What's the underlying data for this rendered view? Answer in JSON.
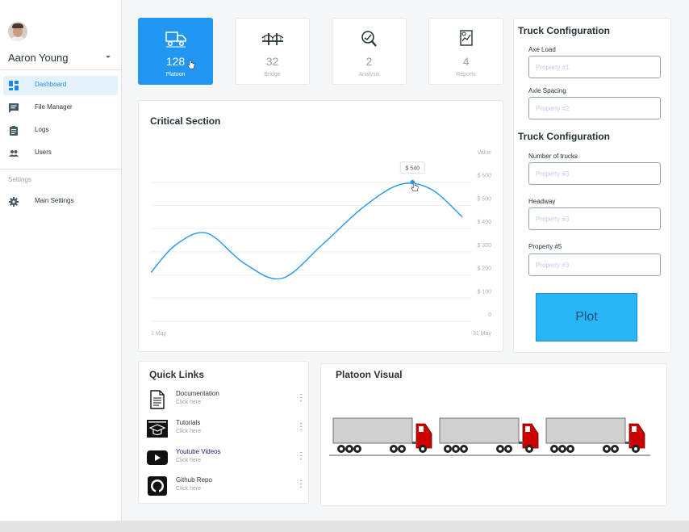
{
  "user": {
    "name": "Aaron Young"
  },
  "nav": {
    "items": [
      {
        "label": "Dashboard",
        "icon": "dashboard-icon",
        "active": true
      },
      {
        "label": "File Manager",
        "icon": "chat-icon"
      },
      {
        "label": "Logs",
        "icon": "clipboard-icon"
      },
      {
        "label": "Users",
        "icon": "people-icon"
      }
    ],
    "settings_section": "Settings",
    "settings_items": [
      {
        "label": "Main Settings",
        "icon": "gear-icon"
      }
    ]
  },
  "stats": [
    {
      "value": "128",
      "label": "Platoon",
      "icon": "truck-icon",
      "active": true
    },
    {
      "value": "32",
      "label": "Bridge",
      "icon": "bridge-icon"
    },
    {
      "value": "2",
      "label": "Analysis",
      "icon": "analysis-icon"
    },
    {
      "value": "4",
      "label": "Reports",
      "icon": "report-icon"
    }
  ],
  "critical": {
    "title": "Critical Section",
    "tooltip": "$ 540",
    "chart_data": {
      "type": "line",
      "title": "Critical Section",
      "y_header": "Value",
      "y_ticks": [
        "0",
        "$ 100",
        "$ 200",
        "$ 300",
        "$ 400",
        "$ 500",
        "$ 600"
      ],
      "ylim": [
        0,
        700
      ],
      "x_ticks": [
        "1 May",
        "31 May"
      ],
      "grid": true,
      "series": [
        {
          "color": "#2196f3",
          "x": [
            0,
            0.08,
            0.18,
            0.3,
            0.42,
            0.55,
            0.68,
            0.8,
            0.9,
            1.0
          ],
          "y": [
            210,
            330,
            380,
            250,
            185,
            330,
            490,
            590,
            570,
            450
          ]
        }
      ],
      "highlight": {
        "x": 0.84,
        "y": 600
      }
    }
  },
  "truck_config": {
    "title1": "Truck Configuration",
    "title2": "Truck Configuration",
    "fields": [
      {
        "label": "Axe Load",
        "placeholder": "Property #1"
      },
      {
        "label": "Axle Spacing",
        "placeholder": "Property #2"
      },
      {
        "label": "Number of trucks",
        "placeholder": "Property #3"
      },
      {
        "label": "Headway",
        "placeholder": "Property #3"
      },
      {
        "label": "Property #5",
        "placeholder": "Property #3"
      }
    ],
    "plot_label": "Plot"
  },
  "quick_links": {
    "title": "Quick Links",
    "items": [
      {
        "title": "Documentation",
        "sub": "Click here",
        "icon": "document-icon"
      },
      {
        "title": "Tutorials",
        "sub": "Click here",
        "icon": "graduation-cap-icon"
      },
      {
        "title": "Youtube Videos",
        "sub": "Click here",
        "icon": "youtube-icon"
      },
      {
        "title": "Github Repo",
        "sub": "Click here",
        "icon": "github-icon"
      }
    ]
  },
  "platoon": {
    "title": "Platoon Visual"
  },
  "colors": {
    "accent": "#2196f3",
    "truck_cab": "#cc0000",
    "plot_button": "#29b6f6"
  }
}
